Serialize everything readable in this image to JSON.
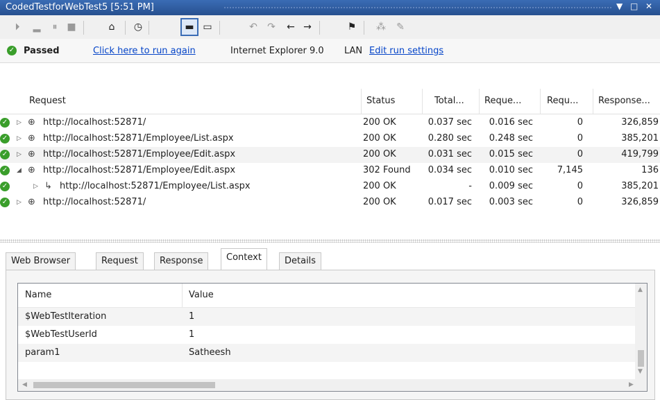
{
  "window": {
    "title": "CodedTestforWebTest5 [5:51 PM]",
    "btn_dropdown": "▼",
    "btn_max": "□",
    "btn_close": "✕"
  },
  "toolbar": {
    "icons": [
      "play-icon",
      "chart-icon",
      "pause-icon",
      "stop-icon",
      "browser-icon",
      "clock-icon",
      "window-icon",
      "folder-icon",
      "undo-icon",
      "redo-icon",
      "back-icon",
      "forward-icon",
      "user-icon",
      "tree-icon",
      "report-icon"
    ]
  },
  "status": {
    "result": "Passed",
    "run_again": "Click here to run again",
    "browser": "Internet Explorer 9.0",
    "network": "LAN",
    "edit_settings": "Edit run settings"
  },
  "grid": {
    "columns": [
      "Request",
      "Status",
      "Total...",
      "Reque...",
      "Requ...",
      "Response..."
    ],
    "rows": [
      {
        "url": "http://localhost:52871/",
        "status": "200 OK",
        "total": "0.037 sec",
        "request": "0.016 sec",
        "req_size": "0",
        "response": "326,859",
        "indent": 0,
        "expanded": false
      },
      {
        "url": "http://localhost:52871/Employee/List.aspx",
        "status": "200 OK",
        "total": "0.280 sec",
        "request": "0.248 sec",
        "req_size": "0",
        "response": "385,201",
        "indent": 0,
        "expanded": false
      },
      {
        "url": "http://localhost:52871/Employee/Edit.aspx",
        "status": "200 OK",
        "total": "0.031 sec",
        "request": "0.015 sec",
        "req_size": "0",
        "response": "419,799",
        "indent": 0,
        "expanded": false
      },
      {
        "url": "http://localhost:52871/Employee/Edit.aspx",
        "status": "302 Found",
        "total": "0.034 sec",
        "request": "0.010 sec",
        "req_size": "7,145",
        "response": "136",
        "indent": 0,
        "expanded": true
      },
      {
        "url": "http://localhost:52871/Employee/List.aspx",
        "status": "200 OK",
        "total": "-",
        "request": "0.009 sec",
        "req_size": "0",
        "response": "385,201",
        "indent": 1,
        "expanded": false
      },
      {
        "url": "http://localhost:52871/",
        "status": "200 OK",
        "total": "0.017 sec",
        "request": "0.003 sec",
        "req_size": "0",
        "response": "326,859",
        "indent": 0,
        "expanded": false
      }
    ]
  },
  "tabs": [
    "Web Browser",
    "Request",
    "Response",
    "Context",
    "Details"
  ],
  "context": {
    "columns": [
      "Name",
      "Value"
    ],
    "rows": [
      {
        "name": "$WebTestIteration",
        "value": "1"
      },
      {
        "name": "$WebTestUserId",
        "value": "1"
      },
      {
        "name": "param1",
        "value": "Satheesh"
      }
    ]
  }
}
